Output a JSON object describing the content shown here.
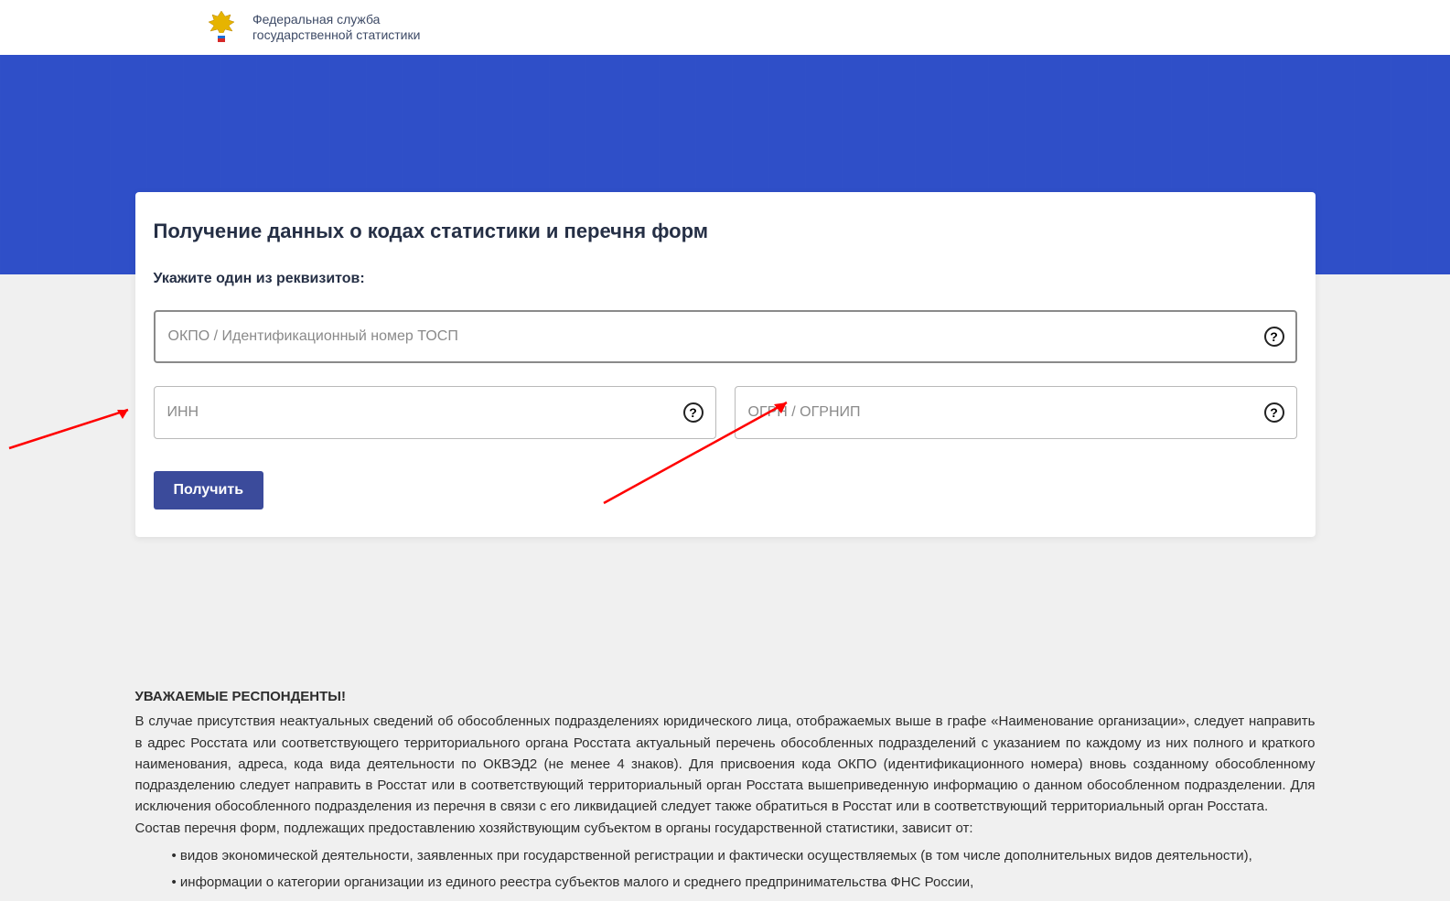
{
  "header": {
    "org_line1": "Федеральная служба",
    "org_line2": "государственной статистики"
  },
  "card": {
    "title": "Получение данных о кодах статистики и перечня форм",
    "subtitle": "Укажите один из реквизитов:",
    "fields": {
      "okpo": {
        "placeholder": "ОКПО / Идентификационный номер ТОСП"
      },
      "inn": {
        "placeholder": "ИНН"
      },
      "ogrn": {
        "placeholder": "ОГРН / ОГРНИП"
      }
    },
    "submit_label": "Получить",
    "help_symbol": "?"
  },
  "info": {
    "heading": "УВАЖАЕМЫЕ РЕСПОНДЕНТЫ!",
    "paragraph": "В случае присутствия неактуальных сведений об обособленных подразделениях юридического лица, отображаемых выше в графе «Наименование организации», следует направить в адрес Росстата или соответствующего территориального органа Росстата актуальный перечень обособленных подразделений с указанием по каждому из них полного и краткого наименования, адреса, кода вида деятельности по ОКВЭД2 (не менее 4 знаков). Для присвоения кода ОКПО (идентификационного номера) вновь созданному обособленному подразделению следует направить в Росстат или в соответствующий территориальный орган Росстата вышеприведенную информацию о данном обособленном подразделении. Для исключения обособленного подразделения из перечня в связи с его ликвидацией следует также обратиться в Росстат или в соответствующий территориальный орган Росстата.",
    "list_intro": "Состав перечня форм, подлежащих предоставлению хозяйствующим субъектом в органы государственной статистики, зависит от:",
    "list": [
      "видов экономической деятельности, заявленных при государственной регистрации и фактически осуществляемых (в том числе дополнительных видов деятельности),",
      "информации о категории организации из единого реестра субъектов малого и среднего предпринимательства ФНС России,"
    ]
  }
}
